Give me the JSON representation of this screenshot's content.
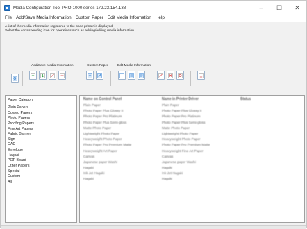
{
  "window": {
    "title": "Media Configuration Tool   PRO-1000 series   172.23.154.138",
    "controls": {
      "minimize": "–",
      "maximize": "☐",
      "close": "✕"
    }
  },
  "menu": [
    "File",
    "Add/Save Media Information",
    "Custom Paper",
    "Edit Media Information",
    "Help"
  ],
  "info": {
    "line1": "A list of the media information registered to the base printer is displayed.",
    "line2": "Select the corresponding icon for operations such as adding/editing media information."
  },
  "toolbar": {
    "groups": {
      "add_save": "Add/Save Media Information",
      "custom": "Custom Paper",
      "edit": "Edit Media Information"
    },
    "colors": {
      "accent": "#2e7fd3",
      "green": "#3aa24a",
      "red": "#d94a4a"
    }
  },
  "categories": {
    "header": "Paper Category",
    "items": [
      "Plain Papers",
      "Coated Papers",
      "Photo Papers",
      "Proofing Papers",
      "Fine Art Papers",
      "Fabric Banner",
      "Sign",
      "CAD",
      "Envelope",
      "Hagaki",
      "POP Board",
      "Other Papers",
      "Special",
      "Custom",
      "All"
    ]
  },
  "media_table": {
    "columns": [
      "Name on Control Panel",
      "Name in Printer Driver",
      "Status"
    ],
    "rows": [
      [
        "Plain Paper",
        "Plain Paper",
        ""
      ],
      [
        "Photo Paper Plus Glossy II",
        "Photo Paper Plus Glossy II",
        ""
      ],
      [
        "Photo Paper Pro Platinum",
        "Photo Paper Pro Platinum",
        ""
      ],
      [
        "Photo Paper Plus Semi-gloss",
        "Photo Paper Plus Semi-gloss",
        ""
      ],
      [
        "Matte Photo Paper",
        "Matte Photo Paper",
        ""
      ],
      [
        "Lightweight Photo Paper",
        "Lightweight Photo Paper",
        ""
      ],
      [
        "Heavyweight Photo Paper",
        "Heavyweight Photo Paper",
        ""
      ],
      [
        "Photo Paper Pro Premium Matte",
        "Photo Paper Pro Premium Matte",
        ""
      ],
      [
        "Heavyweight Art Paper",
        "Heavyweight Fine Art Paper",
        ""
      ],
      [
        "Canvas",
        "Canvas",
        ""
      ],
      [
        "Japanese paper Washi",
        "Japanese paper Washi",
        ""
      ],
      [
        "Hagaki",
        "Hagaki",
        ""
      ],
      [
        "Ink Jet Hagaki",
        "Ink Jet Hagaki",
        ""
      ],
      [
        "Hagaki",
        "Hagaki",
        ""
      ]
    ]
  }
}
